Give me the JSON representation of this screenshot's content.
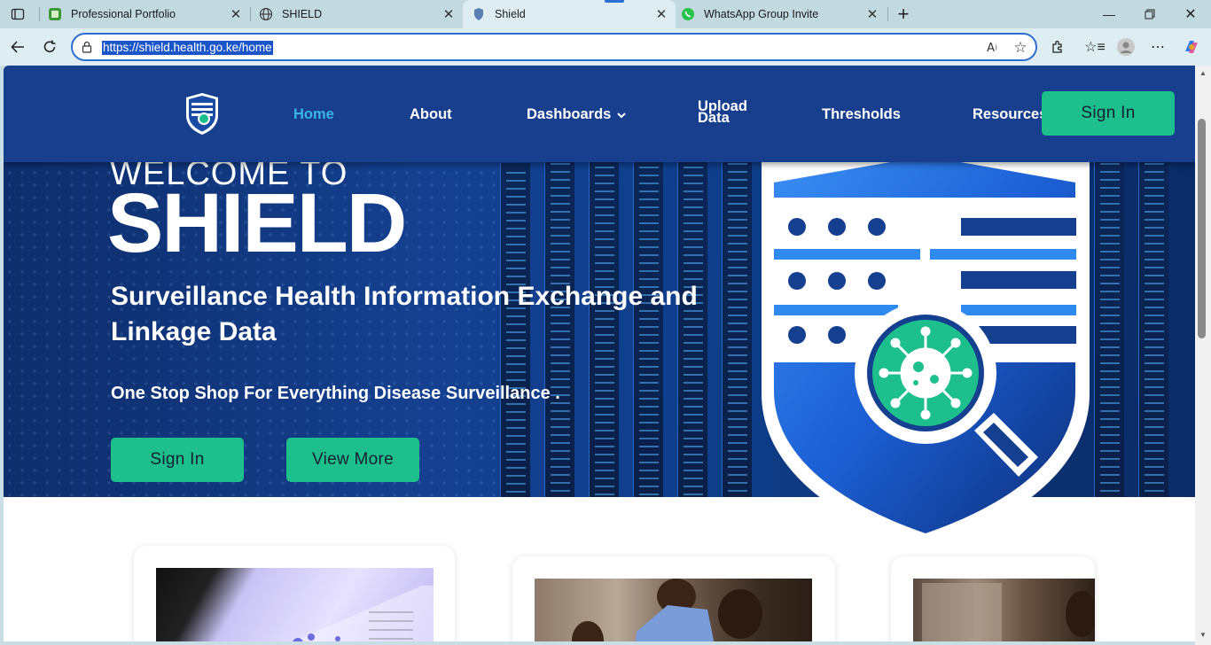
{
  "browser": {
    "tabs": [
      {
        "title": "Professional Portfolio",
        "icon": "portfolio-favicon",
        "active": false
      },
      {
        "title": "SHIELD",
        "icon": "globe-icon",
        "active": false
      },
      {
        "title": "Shield",
        "icon": "shield-favicon",
        "active": true
      },
      {
        "title": "WhatsApp Group Invite",
        "icon": "whatsapp-icon",
        "active": false
      }
    ],
    "url": "https://shield.health.go.ke/home"
  },
  "nav": {
    "items": [
      {
        "label": "Home",
        "active": true
      },
      {
        "label": "About"
      },
      {
        "label": "Dashboards",
        "icon": "chevron-down-icon"
      },
      {
        "label": "Upload Data"
      },
      {
        "label": "Thresholds"
      },
      {
        "label": "Resources"
      }
    ],
    "sign_in": "Sign In"
  },
  "hero": {
    "welcome": "WELCOME TO",
    "title": "SHIELD",
    "subtitle": "Surveillance Health Information Exchange and Linkage Data",
    "tagline": "One Stop Shop For Everything Disease Surveillance .",
    "buttons": {
      "sign_in": "Sign In",
      "view_more": "View More"
    }
  },
  "colors": {
    "nav_bg": "#183f8d",
    "accent_green": "#1dbf8c",
    "active_link": "#3ab3e8",
    "hero_bg": "#14408f"
  }
}
